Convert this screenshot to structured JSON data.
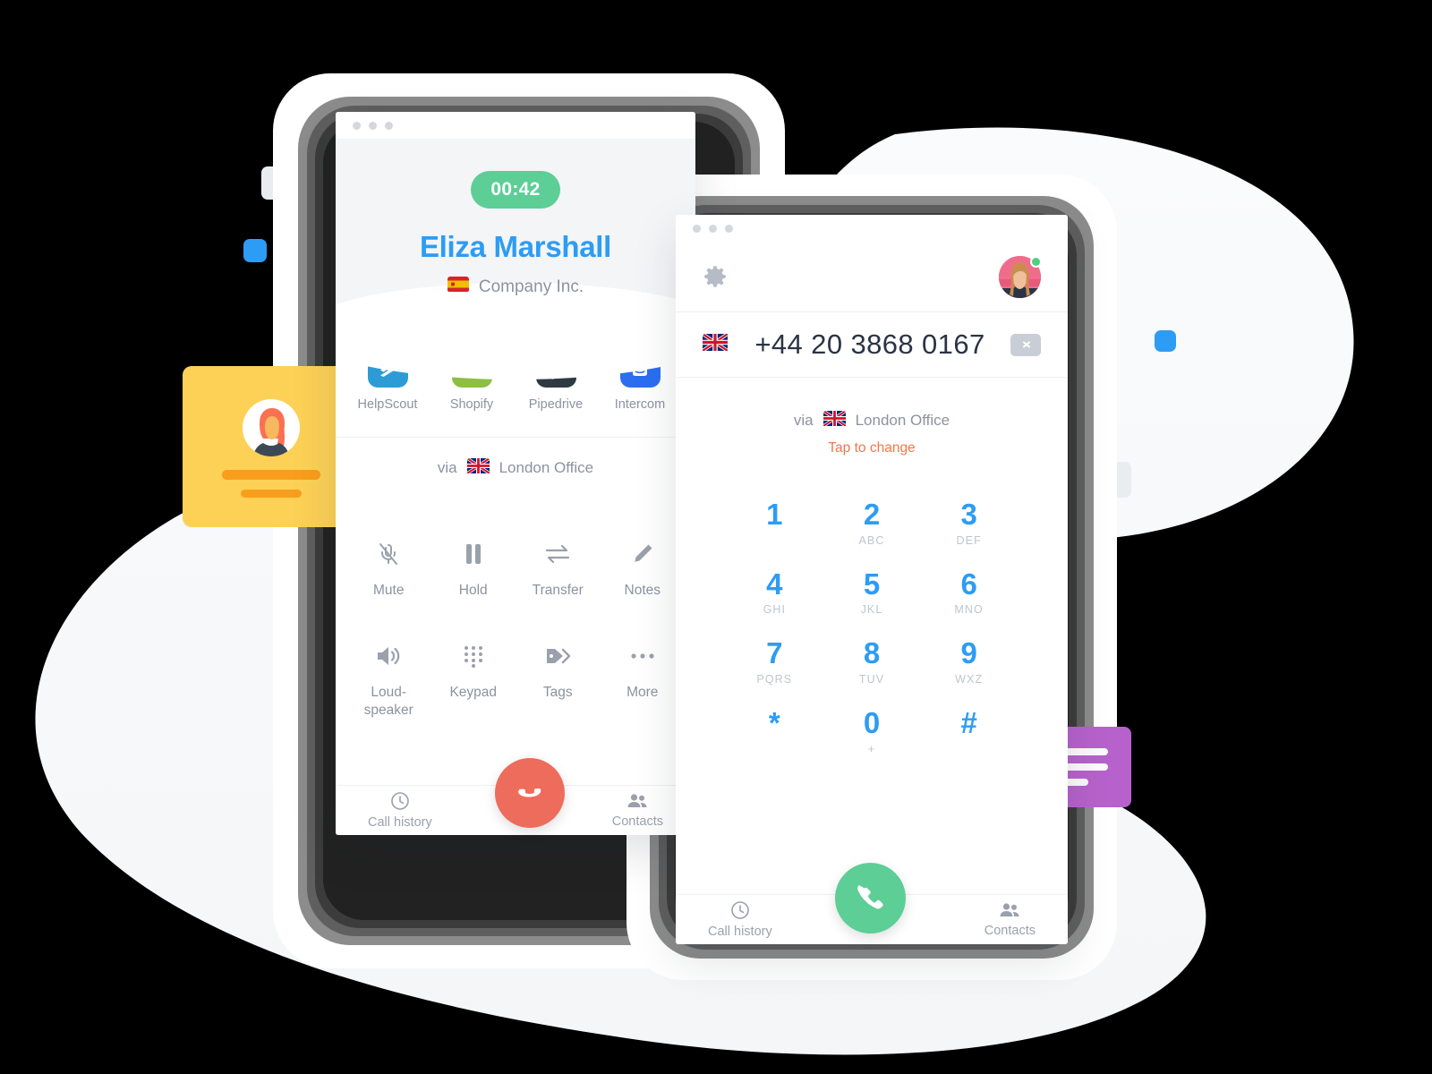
{
  "call_window": {
    "titlebar_dots": 3,
    "timer": "00:42",
    "caller_name": "Eliza Marshall",
    "company": "Company Inc.",
    "company_flag": "flag-spain",
    "integrations": [
      {
        "label": "HelpScout",
        "icon": "helpscout-icon",
        "color": "#2D9CD6"
      },
      {
        "label": "Shopify",
        "icon": "shopify-icon",
        "color": "#8DBF42"
      },
      {
        "label": "Pipedrive",
        "icon": "pipedrive-icon",
        "color": "#2D3A42"
      },
      {
        "label": "Intercom",
        "icon": "intercom-icon",
        "color": "#2C6EF2"
      }
    ],
    "via_prefix": "via",
    "via_flag": "flag-uk",
    "via_location": "London Office",
    "controls": [
      {
        "label": "Mute",
        "icon": "microphone-off-icon"
      },
      {
        "label": "Hold",
        "icon": "pause-icon"
      },
      {
        "label": "Transfer",
        "icon": "transfer-arrows-icon"
      },
      {
        "label": "Notes",
        "icon": "pencil-icon"
      },
      {
        "label": "Loud-\nspeaker",
        "icon": "speaker-icon"
      },
      {
        "label": "Keypad",
        "icon": "keypad-dots-icon"
      },
      {
        "label": "Tags",
        "icon": "tag-icon"
      },
      {
        "label": "More",
        "icon": "ellipsis-icon"
      }
    ],
    "bottom": {
      "call_history": "Call history",
      "contacts": "Contacts",
      "hangup_icon": "hangup-phone-icon",
      "hangup_color": "#EE6C5B"
    }
  },
  "dial_window": {
    "titlebar_dots": 3,
    "settings_icon": "gear-icon",
    "avatar_icon": "user-avatar",
    "status": "online",
    "number_flag": "flag-uk",
    "phone_number": "+44 20 3868 0167",
    "backspace_icon": "backspace-icon",
    "via_prefix": "via",
    "via_flag": "flag-uk",
    "via_location": "London Office",
    "tap_to_change": "Tap to change",
    "keys": [
      {
        "digit": "1",
        "letters": ""
      },
      {
        "digit": "2",
        "letters": "ABC"
      },
      {
        "digit": "3",
        "letters": "DEF"
      },
      {
        "digit": "4",
        "letters": "GHI"
      },
      {
        "digit": "5",
        "letters": "JKL"
      },
      {
        "digit": "6",
        "letters": "MNO"
      },
      {
        "digit": "7",
        "letters": "PQRS"
      },
      {
        "digit": "8",
        "letters": "TUV"
      },
      {
        "digit": "9",
        "letters": "WXZ"
      },
      {
        "digit": "*",
        "letters": ""
      },
      {
        "digit": "0",
        "letters": "+"
      },
      {
        "digit": "#",
        "letters": ""
      }
    ],
    "bottom": {
      "call_history": "Call history",
      "contacts": "Contacts",
      "call_icon": "call-phone-icon",
      "call_color": "#5DCE96"
    }
  },
  "decor": {
    "contact_card_icon": "contact-card-illustration",
    "message_card_icon": "message-bubble-illustration",
    "blue": "#2D9CF5",
    "yellow": "#FCD156",
    "orange": "#F99D1C",
    "purple": "#B762CC",
    "grey_square": "#E9EDF0"
  }
}
